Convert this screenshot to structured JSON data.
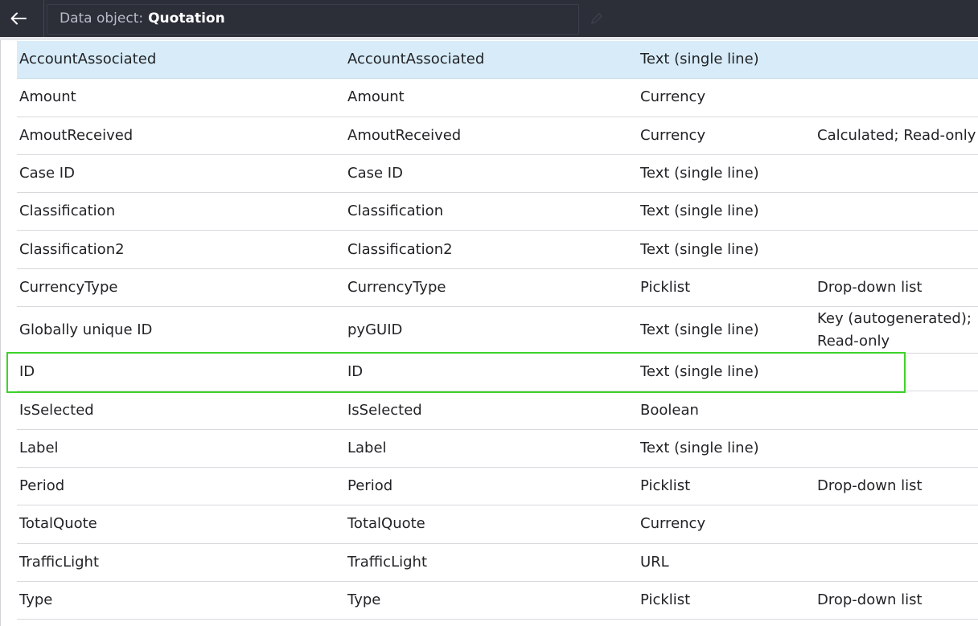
{
  "header": {
    "title_prefix": "Data object:",
    "title_name": "Quotation",
    "back_icon": "arrow-left-icon",
    "edit_icon": "pencil-icon"
  },
  "colors": {
    "topbar": "#2c2e38",
    "selected_row": "#d7ecf8",
    "highlight": "#3ed32a"
  },
  "rows": [
    {
      "name": "AccountAssociated",
      "id": "AccountAssociated",
      "type": "Text (single line)",
      "options": ""
    },
    {
      "name": "Amount",
      "id": "Amount",
      "type": "Currency",
      "options": ""
    },
    {
      "name": "AmoutReceived",
      "id": "AmoutReceived",
      "type": "Currency",
      "options": "Calculated; Read-only"
    },
    {
      "name": "Case ID",
      "id": "Case ID",
      "type": "Text (single line)",
      "options": ""
    },
    {
      "name": "Classification",
      "id": "Classification",
      "type": "Text (single line)",
      "options": ""
    },
    {
      "name": "Classification2",
      "id": "Classification2",
      "type": "Text (single line)",
      "options": ""
    },
    {
      "name": "CurrencyType",
      "id": "CurrencyType",
      "type": "Picklist",
      "options": "Drop-down list"
    },
    {
      "name": "Globally unique ID",
      "id": "pyGUID",
      "type": "Text (single line)",
      "options": "Key (autogenerated); Read-only"
    },
    {
      "name": "ID",
      "id": "ID",
      "type": "Text (single line)",
      "options": ""
    },
    {
      "name": "IsSelected",
      "id": "IsSelected",
      "type": "Boolean",
      "options": ""
    },
    {
      "name": "Label",
      "id": "Label",
      "type": "Text (single line)",
      "options": ""
    },
    {
      "name": "Period",
      "id": "Period",
      "type": "Picklist",
      "options": "Drop-down list"
    },
    {
      "name": "TotalQuote",
      "id": "TotalQuote",
      "type": "Currency",
      "options": ""
    },
    {
      "name": "TrafficLight",
      "id": "TrafficLight",
      "type": "URL",
      "options": ""
    },
    {
      "name": "Type",
      "id": "Type",
      "type": "Picklist",
      "options": "Drop-down list"
    }
  ]
}
